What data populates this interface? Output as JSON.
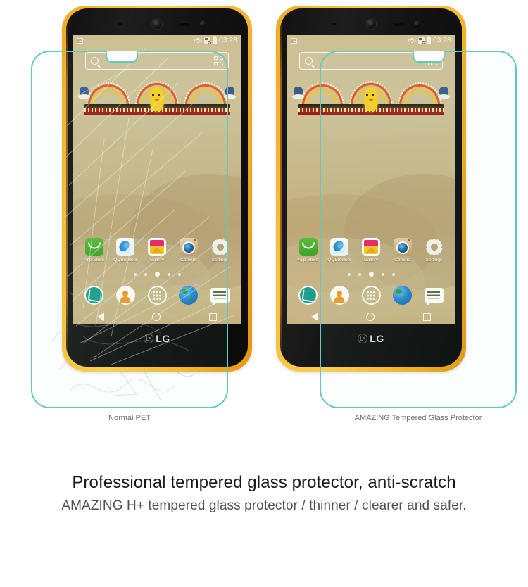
{
  "promo": {
    "headline": "Professional tempered glass protector, anti-scratch",
    "subline": "AMAZING H+ tempered glass protector / thinner / clearer and safer."
  },
  "comparison": {
    "left": {
      "caption": "Normal PET",
      "scratched": true
    },
    "right": {
      "caption": "AMAZING Tempered Glass Protector",
      "scratched": false
    }
  },
  "colors": {
    "protector_outline": "#63c9bd",
    "case_orange": "#f6bd35",
    "phone_body": "#121212",
    "wallpaper_sand": "#c9b98c",
    "headline": "#1a1a1a",
    "subline": "#4f4f4f",
    "caption": "#6b6b6b"
  },
  "phone": {
    "brand": "LG",
    "status_bar": {
      "time": "03:28",
      "icons_left": [
        "gallery-icon"
      ],
      "icons_right": [
        "wifi-icon",
        "sim-card-icon",
        "battery-icon"
      ]
    },
    "search": {
      "placeholder": "",
      "icon": "search-icon",
      "trailing_icon": "qr-code-icon"
    },
    "apps": [
      {
        "label": "App Store",
        "icon": "app-store-icon"
      },
      {
        "label": "QQBrowser",
        "icon": "qq-browser-icon"
      },
      {
        "label": "Gallery",
        "icon": "gallery-icon"
      },
      {
        "label": "Camera",
        "icon": "camera-icon"
      },
      {
        "label": "Settings",
        "icon": "settings-gear-icon"
      }
    ],
    "page_dots": {
      "count": 5,
      "active_index": 2
    },
    "dock": [
      {
        "icon": "phone-dialer-icon"
      },
      {
        "icon": "contacts-icon"
      },
      {
        "icon": "app-drawer-icon"
      },
      {
        "icon": "browser-globe-icon"
      },
      {
        "icon": "messages-icon"
      }
    ],
    "nav_bar": [
      "back-icon",
      "home-icon",
      "recents-icon"
    ],
    "hardware": [
      "proximity-sensor",
      "front-camera",
      "earpiece-speaker",
      "light-sensor"
    ]
  }
}
